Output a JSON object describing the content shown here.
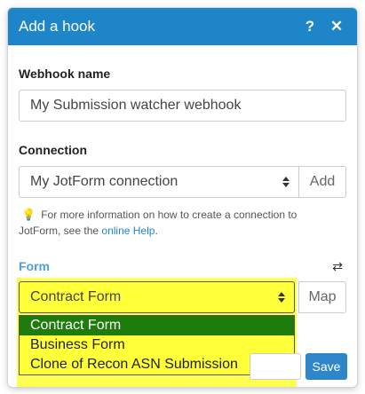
{
  "dialog": {
    "title": "Add a hook",
    "help_icon": "?",
    "close_icon": "✕"
  },
  "webhook_name": {
    "label": "Webhook name",
    "value": "My Submission watcher webhook"
  },
  "connection": {
    "label": "Connection",
    "value": "My JotForm connection",
    "add_label": "Add",
    "hint_text": "For more information on how to create a connection to JotForm, see the",
    "hint_link": "online Help",
    "hint_end": "."
  },
  "form": {
    "label": "Form",
    "value": "Contract Form",
    "map_label": "Map",
    "options": [
      "Contract Form",
      "Business Form",
      "Clone of Recon ASN Submission"
    ]
  },
  "footer": {
    "save_label": "Save"
  },
  "colors": {
    "header": "#1f85c9",
    "highlight": "#ffff33",
    "selected_option": "#1e7c0c"
  }
}
